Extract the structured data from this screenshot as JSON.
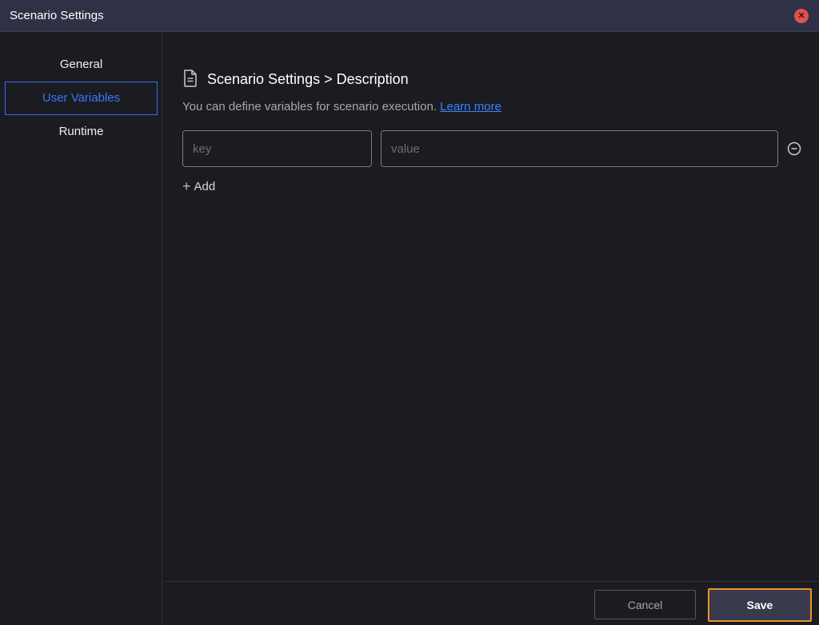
{
  "window": {
    "title": "Scenario Settings"
  },
  "sidebar": {
    "items": [
      {
        "label": "General",
        "active": false
      },
      {
        "label": "User Variables",
        "active": true
      },
      {
        "label": "Runtime",
        "active": false
      }
    ]
  },
  "main": {
    "heading": "Scenario Settings > Description",
    "description": "You can define variables for scenario execution.",
    "learn_more": "Learn more",
    "variables": [
      {
        "key": "",
        "value": "",
        "key_placeholder": "key",
        "value_placeholder": "value"
      }
    ],
    "add_label": "Add"
  },
  "footer": {
    "cancel_label": "Cancel",
    "save_label": "Save"
  },
  "colors": {
    "accent": "#3b68f0",
    "focus_ring": "#f0902a",
    "close": "#e0534a"
  }
}
